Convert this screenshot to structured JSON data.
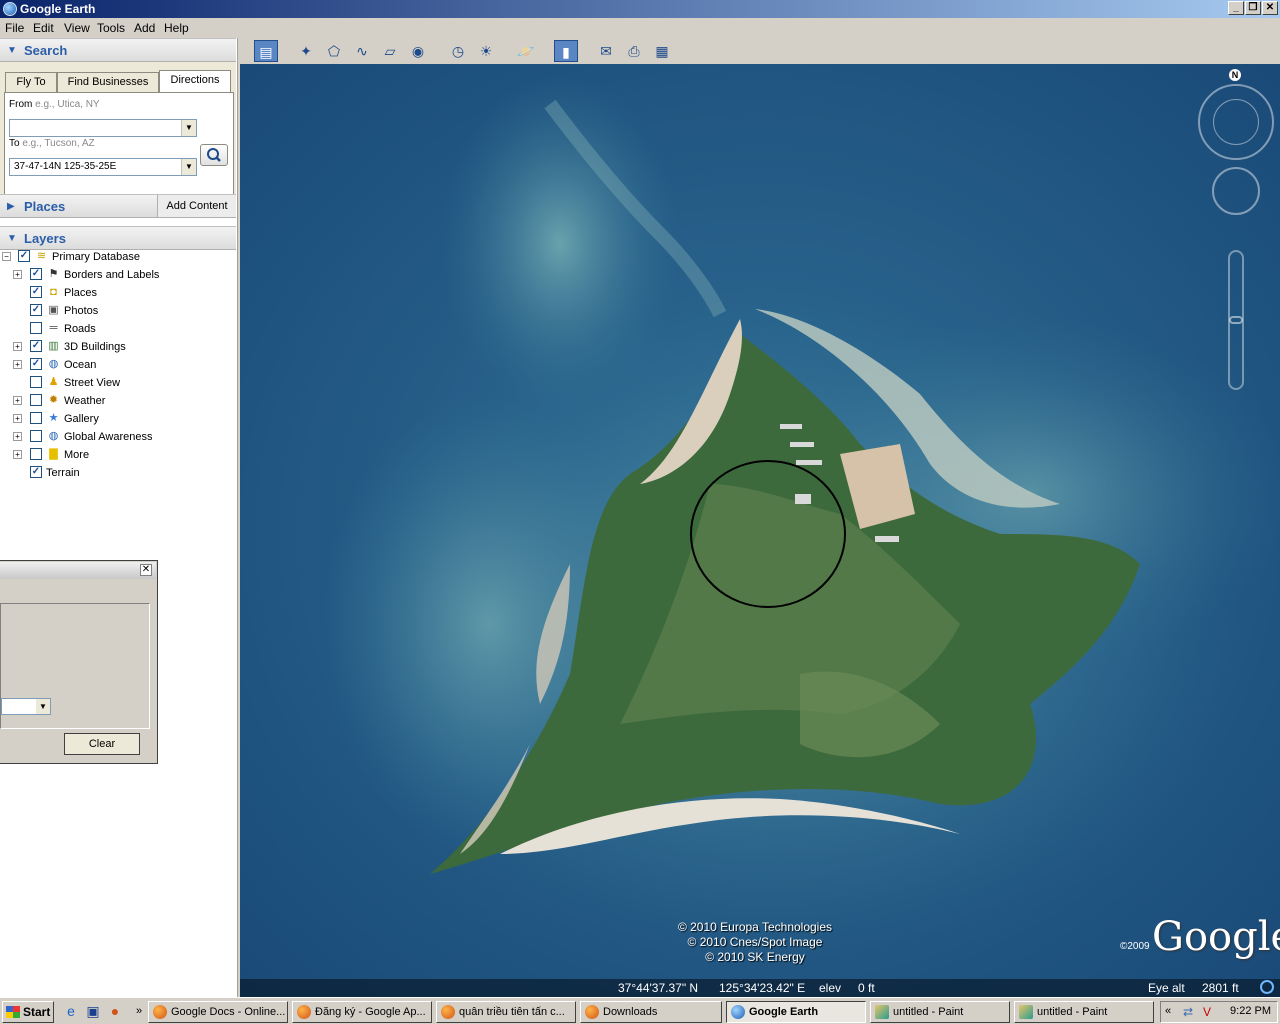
{
  "window": {
    "title": "Google Earth"
  },
  "menu": [
    "File",
    "Edit",
    "View",
    "Tools",
    "Add",
    "Help"
  ],
  "search": {
    "title": "Search",
    "tabs": [
      "Fly To",
      "Find Businesses",
      "Directions"
    ],
    "active_tab": "Directions",
    "from_label": "From",
    "from_placeholder": "e.g., Utica, NY",
    "from_value": "",
    "to_label": "To",
    "to_placeholder": "e.g., Tucson, AZ",
    "to_value": "37-47-14N 125-35-25E"
  },
  "places": {
    "title": "Places",
    "add_content": "Add Content"
  },
  "layers": {
    "title": "Layers",
    "items": [
      {
        "label": "Primary Database",
        "checked": true,
        "icon": "database-icon"
      },
      {
        "label": "Borders and Labels",
        "checked": true,
        "icon": "flag-icon"
      },
      {
        "label": "Places",
        "checked": true,
        "icon": "places-icon"
      },
      {
        "label": "Photos",
        "checked": true,
        "icon": "photo-icon"
      },
      {
        "label": "Roads",
        "checked": false,
        "icon": "road-icon"
      },
      {
        "label": "3D Buildings",
        "checked": true,
        "icon": "building-icon"
      },
      {
        "label": "Ocean",
        "checked": true,
        "icon": "globe-icon"
      },
      {
        "label": "Street View",
        "checked": false,
        "icon": "person-icon"
      },
      {
        "label": "Weather",
        "checked": false,
        "icon": "sun-icon"
      },
      {
        "label": "Gallery",
        "checked": false,
        "icon": "star-icon"
      },
      {
        "label": "Global Awareness",
        "checked": false,
        "icon": "globe-icon"
      },
      {
        "label": "More",
        "checked": false,
        "icon": "folder-icon"
      },
      {
        "label": "Terrain",
        "checked": true,
        "icon": ""
      }
    ]
  },
  "dialog": {
    "clear_label": "Clear"
  },
  "map": {
    "compass_label": "N",
    "credits": [
      "© 2010 Europa Technologies",
      "© 2010 Cnes/Spot Image",
      "© 2010 SK Energy"
    ],
    "logo": "Google",
    "logo_year": "©2009",
    "status": {
      "lat": "37°44'37.37\" N",
      "lon": "125°34'23.42\" E",
      "elev_label": "elev",
      "elev_value": "0 ft",
      "eye_label": "Eye alt",
      "eye_value": "2801 ft"
    }
  },
  "taskbar": {
    "start": "Start",
    "tasks": [
      "Google Docs - Online...",
      "Đăng ký - Google Ap...",
      "quân triều tiên tấn c...",
      "Downloads",
      "Google Earth",
      "untitled - Paint",
      "untitled - Paint"
    ],
    "active_task": "Google Earth",
    "clock": "9:22 PM"
  }
}
